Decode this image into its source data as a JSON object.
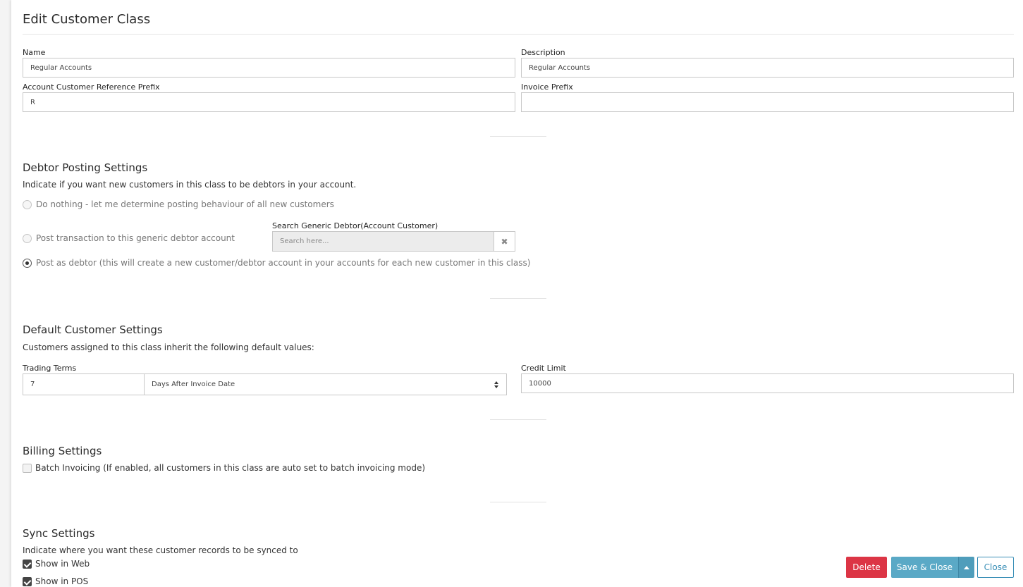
{
  "page": {
    "title": "Edit Customer Class"
  },
  "form": {
    "name_label": "Name",
    "name_value": "Regular Accounts",
    "description_label": "Description",
    "description_value": "Regular Accounts",
    "ref_prefix_label": "Account Customer Reference Prefix",
    "ref_prefix_value": "R",
    "invoice_prefix_label": "Invoice Prefix",
    "invoice_prefix_value": ""
  },
  "debtor": {
    "title": "Debtor Posting Settings",
    "description": "Indicate if you want new customers in this class to be debtors in your account.",
    "options": [
      {
        "label": "Do nothing - let me determine posting behaviour of all new customers",
        "selected": false
      },
      {
        "label": "Post transaction to this generic debtor account",
        "selected": false
      },
      {
        "label": "Post as debtor (this will create a new customer/debtor account in your accounts for each new customer in this class)",
        "selected": true
      }
    ],
    "search_label": "Search Generic Debtor(Account Customer)",
    "search_placeholder": "Search here...",
    "clear_glyph": "✖"
  },
  "defaults": {
    "title": "Default Customer Settings",
    "description": "Customers assigned to this class inherit the following default values:",
    "trading_terms_label": "Trading Terms",
    "trading_terms_days": "7",
    "trading_terms_type": "Days After Invoice Date",
    "credit_limit_label": "Credit Limit",
    "credit_limit_value": "10000"
  },
  "billing": {
    "title": "Billing Settings",
    "batch_invoicing_label": "Batch Invoicing (If enabled, all customers in this class are auto set to batch invoicing mode)",
    "batch_invoicing_checked": false
  },
  "sync": {
    "title": "Sync Settings",
    "description": "Indicate where you want these customer records to be synced to",
    "show_web_label": "Show in Web",
    "show_web_checked": true,
    "show_pos_label": "Show in POS",
    "show_pos_checked": true
  },
  "actions": {
    "delete_label": "Delete",
    "save_close_label": "Save & Close",
    "close_label": "Close"
  },
  "colors": {
    "delete": "#dc3545",
    "save": "#5aa9c6",
    "save_caret": "#4f9dbb",
    "close": "#3a8fb7"
  }
}
